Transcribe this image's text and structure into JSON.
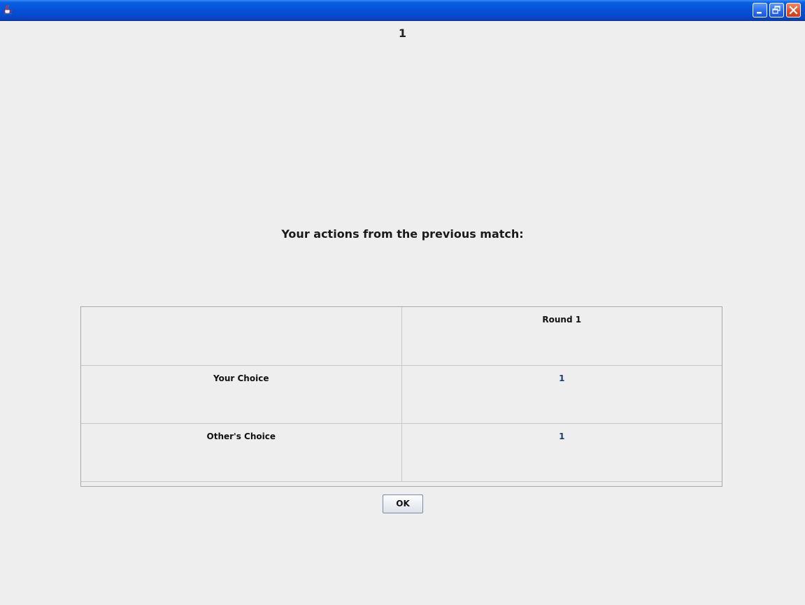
{
  "window": {
    "controls": {
      "minimize_icon": "minimize-icon",
      "maximize_icon": "restore-icon",
      "close_icon": "close-icon"
    }
  },
  "main": {
    "round_number": "1",
    "heading": "Your actions from the previous match:",
    "table": {
      "header": [
        "",
        "Round 1"
      ],
      "rows": [
        {
          "label": "Your Choice",
          "value": "1"
        },
        {
          "label": "Other's Choice",
          "value": "1"
        }
      ]
    },
    "ok_label": "OK"
  },
  "colors": {
    "background": "#eeeeee",
    "titlebar": "#0651d8",
    "value_text": "#1c3b7a"
  }
}
